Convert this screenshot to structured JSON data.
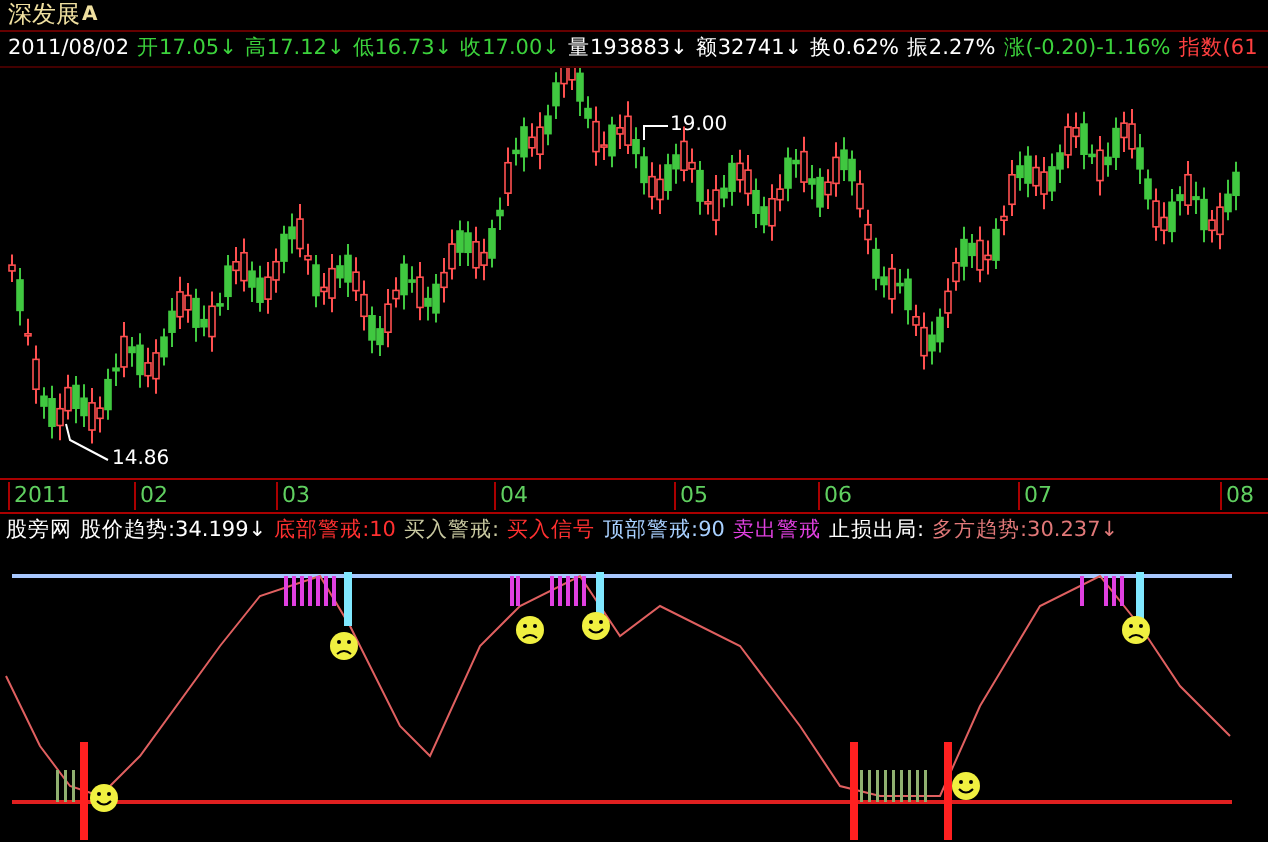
{
  "stock": {
    "name": "深发展",
    "badge": "A"
  },
  "quote": [
    {
      "text": "2011/08/02",
      "color": "#ffffff"
    },
    {
      "text": "开17.05↓",
      "color": "#3cd23c"
    },
    {
      "text": "高17.12↓",
      "color": "#3cd23c"
    },
    {
      "text": "低16.73↓",
      "color": "#3cd23c"
    },
    {
      "text": "收17.00↓",
      "color": "#3cd23c"
    },
    {
      "text": "量193883↓",
      "color": "#ffffff"
    },
    {
      "text": "额32741↓",
      "color": "#ffffff"
    },
    {
      "text": "换0.62%",
      "color": "#ffffff"
    },
    {
      "text": "振2.27%",
      "color": "#ffffff"
    },
    {
      "text": "涨(-0.20)-1.16%",
      "color": "#3cd23c"
    },
    {
      "text": "指数(61",
      "color": "#ff4040"
    }
  ],
  "price_chart": {
    "high_label": "19.00",
    "low_label": "14.86"
  },
  "months": [
    "2011",
    "02",
    "03",
    "04",
    "05",
    "06",
    "07",
    "08"
  ],
  "indicator": {
    "items": [
      {
        "text": "股旁网",
        "color": "#ffffff"
      },
      {
        "text": "股价趋势:34.199↓",
        "color": "#ffffff"
      },
      {
        "text": "底部警戒:10",
        "color": "#ff3030"
      },
      {
        "text": "买入警戒:",
        "color": "#c8c8a0"
      },
      {
        "text": "买入信号",
        "color": "#ff3030"
      },
      {
        "text": "顶部警戒:90",
        "color": "#a8d0ff"
      },
      {
        "text": "卖出警戒",
        "color": "#e040e0"
      },
      {
        "text": "止损出局:",
        "color": "#ffffff"
      },
      {
        "text": "多方趋势:30.237↓",
        "color": "#e07878"
      }
    ]
  }
}
